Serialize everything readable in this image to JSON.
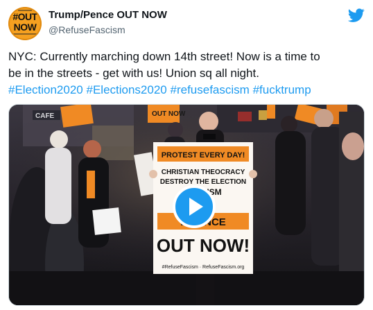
{
  "author": {
    "avatar_text_line1": "#OUT",
    "avatar_text_line2": "NOW",
    "display_name": "Trump/Pence OUT NOW",
    "handle": "@RefuseFascism"
  },
  "tweet": {
    "line1": "NYC: Currently marching down 14th street! Now is a time to",
    "line2": "be in the streets - get with us! Union sq all night.",
    "hashtags": [
      "#Election2020",
      "#Elections2020",
      "#refusefascism",
      "#fucktrump"
    ]
  },
  "media": {
    "signs": {
      "top_banner": "PROTEST EVERY DAY!",
      "line_a": "CHRISTIAN THEOCRACY",
      "line_b": "DESTROY THE ELECTION",
      "line_c": "FASCISM",
      "pence_text": "P PENCE",
      "big_text": "OUT NOW!",
      "footer": "#RefuseFascism · RefuseFascism.org",
      "small_sign": "OUT NOW",
      "cafe_sign": "CAFE"
    }
  },
  "colors": {
    "twitter_blue": "#1d9bf0",
    "text_primary": "#0f1419",
    "text_secondary": "#536471",
    "sign_orange": "#f08a24",
    "avatar_orange": "#f5a020"
  }
}
